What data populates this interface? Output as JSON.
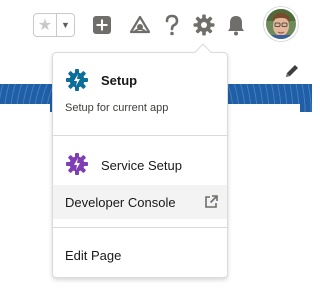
{
  "header": {
    "favorites_icon": "star-icon",
    "favorites_menu_icon": "chevron-down-icon",
    "icons": [
      "add-icon",
      "trailhead-icon",
      "help-icon",
      "gear-icon",
      "bell-icon"
    ],
    "avatar_icon": "user-avatar"
  },
  "page": {
    "edit_icon": "pencil-icon",
    "banner_color": "#1f5fa8"
  },
  "setup_menu": {
    "setup": {
      "label": "Setup",
      "description": "Setup for current app",
      "icon": "gear-icon",
      "icon_color": "#0b6e99"
    },
    "service_setup": {
      "label": "Service Setup",
      "icon": "gear-icon",
      "icon_color": "#7f3fb4"
    },
    "developer_console": {
      "label": "Developer Console",
      "icon": "external-link-icon"
    },
    "edit_page": {
      "label": "Edit Page"
    }
  }
}
